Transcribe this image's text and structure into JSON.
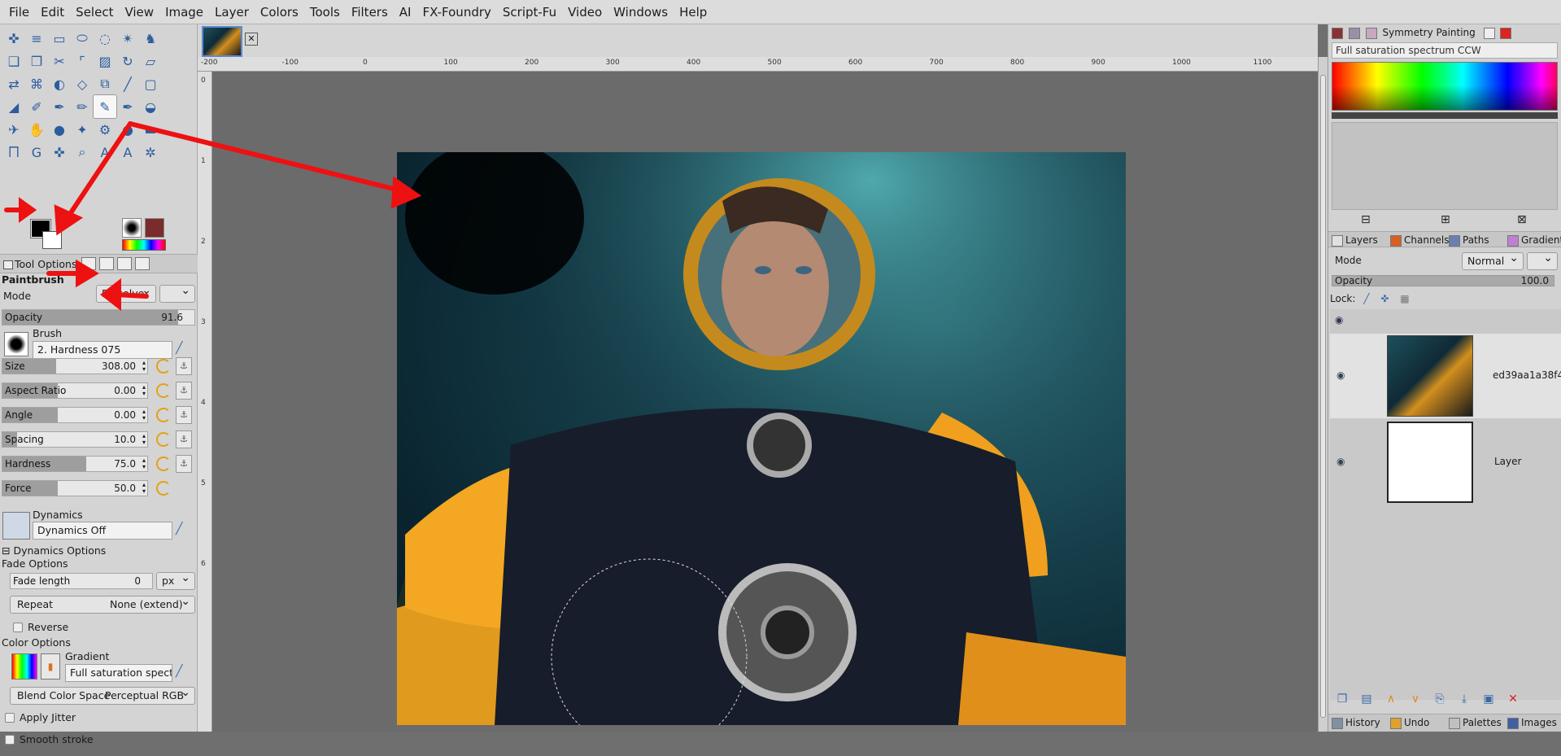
{
  "menu": [
    "File",
    "Edit",
    "Select",
    "View",
    "Image",
    "Layer",
    "Colors",
    "Tools",
    "Filters",
    "AI",
    "FX-Foundry",
    "Script-Fu",
    "Video",
    "Windows",
    "Help"
  ],
  "toolbox": {
    "tool_options_label": "Tool Options",
    "tool_name": "Paintbrush",
    "mode_label": "Mode",
    "mode_value": "Dissolve",
    "opacity_label": "Opacity",
    "opacity_value": "91.6",
    "opacity_fraction": 0.916,
    "brush_label": "Brush",
    "brush_value": "2. Hardness 075",
    "sliders": [
      {
        "label": "Size",
        "value": "308.00",
        "fraction": 0.37
      },
      {
        "label": "Aspect Ratio",
        "value": "0.00",
        "fraction": 0.38
      },
      {
        "label": "Angle",
        "value": "0.00",
        "fraction": 0.38
      },
      {
        "label": "Spacing",
        "value": "10.0",
        "fraction": 0.1
      },
      {
        "label": "Hardness",
        "value": "75.0",
        "fraction": 0.58
      },
      {
        "label": "Force",
        "value": "50.0",
        "fraction": 0.38
      }
    ],
    "dynamics_label": "Dynamics",
    "dynamics_value": "Dynamics Off",
    "dynamics_options_label": "Dynamics Options",
    "fade_options_label": "Fade Options",
    "fade_length_label": "Fade length",
    "fade_length_value": "0",
    "fade_unit": "px",
    "repeat_label": "Repeat",
    "repeat_value": "None (extend)",
    "reverse_label": "Reverse",
    "color_options_label": "Color Options",
    "gradient_label": "Gradient",
    "gradient_value": "Full saturation spectrum",
    "blend_label": "Blend Color Space",
    "blend_value": "Perceptual RGB",
    "apply_jitter_label": "Apply Jitter",
    "smooth_stroke_label": "Smooth stroke"
  },
  "ruler": {
    "h_ticks": [
      "-200",
      "-100",
      "0",
      "100",
      "200",
      "300",
      "400",
      "500",
      "600",
      "700",
      "800",
      "900",
      "1000",
      "1100"
    ],
    "v_ticks": [
      "0",
      "1",
      "2",
      "3",
      "4",
      "5",
      "6"
    ]
  },
  "dock": {
    "top_tab": "Symmetry Painting",
    "gradient_name": "Full saturation spectrum CCW",
    "layer_tabs": [
      "Layers",
      "Channels",
      "Paths",
      "Gradients"
    ],
    "mode_label": "Mode",
    "mode_value": "Normal",
    "opacity_label": "Opacity",
    "opacity_value": "100.0",
    "lock_label": "Lock:",
    "layers": [
      {
        "name": "ed39aa1a38f4"
      },
      {
        "name": "Layer"
      }
    ],
    "bottom_tabs": [
      "History",
      "Undo",
      "Palettes",
      "Images"
    ]
  }
}
